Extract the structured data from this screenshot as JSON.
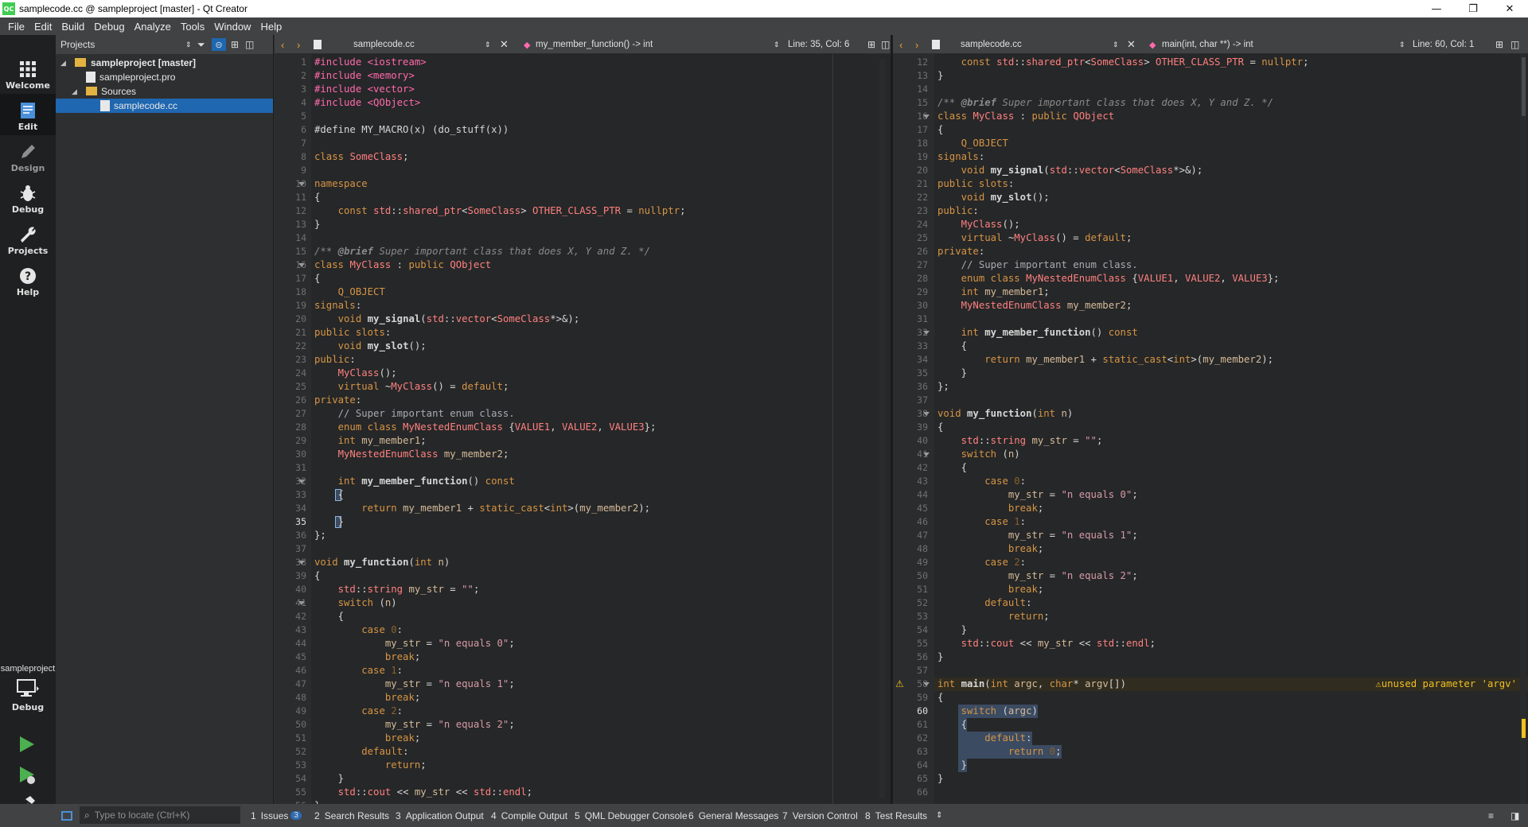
{
  "window": {
    "title": "samplecode.cc @ sampleproject [master] - Qt Creator",
    "app_badge": "QC",
    "minimize": "—",
    "maximize": "❐",
    "close": "✕"
  },
  "menu": [
    "File",
    "Edit",
    "Build",
    "Debug",
    "Analyze",
    "Tools",
    "Window",
    "Help"
  ],
  "modes": [
    {
      "label": "Welcome",
      "icon": "grid-icon"
    },
    {
      "label": "Edit",
      "icon": "edit-document-icon"
    },
    {
      "label": "Design",
      "icon": "pencil-icon"
    },
    {
      "label": "Debug",
      "icon": "bug-icon"
    },
    {
      "label": "Projects",
      "icon": "wrench-icon"
    },
    {
      "label": "Help",
      "icon": "help-icon"
    }
  ],
  "kit": {
    "project": "sampleproject",
    "build": "Debug"
  },
  "projects_panel": {
    "selector": "Projects",
    "tree": [
      {
        "label": "sampleproject [master]",
        "level": 0,
        "kind": "project"
      },
      {
        "label": "sampleproject.pro",
        "level": 1,
        "kind": "file"
      },
      {
        "label": "Sources",
        "level": 1,
        "kind": "folder"
      },
      {
        "label": "samplecode.cc",
        "level": 2,
        "kind": "file",
        "selected": true
      }
    ]
  },
  "editor_left": {
    "file": "samplecode.cc",
    "symbol": "my_member_function() -> int",
    "position": "Line: 35, Col: 6",
    "first_line": 1,
    "current_line": 35
  },
  "editor_right": {
    "file": "samplecode.cc",
    "symbol": "main(int, char **) -> int",
    "position": "Line: 60, Col: 1",
    "first_line": 12,
    "current_line": 60,
    "warning_line": 58,
    "warning": "unused parameter 'argv'",
    "warning_icon": "⚠"
  },
  "status": {
    "locator_placeholder": "Type to locate (Ctrl+K)",
    "panes": [
      {
        "num": "1",
        "label": "Issues",
        "badge": "3"
      },
      {
        "num": "2",
        "label": "Search Results"
      },
      {
        "num": "3",
        "label": "Application Output"
      },
      {
        "num": "4",
        "label": "Compile Output"
      },
      {
        "num": "5",
        "label": "QML Debugger Console"
      },
      {
        "num": "6",
        "label": "General Messages"
      },
      {
        "num": "7",
        "label": "Version Control"
      },
      {
        "num": "8",
        "label": "Test Results"
      }
    ]
  },
  "code": [
    "#include <iostream>",
    "#include <memory>",
    "#include <vector>",
    "#include <QObject>",
    "",
    "#define MY_MACRO(x) (do_stuff(x))",
    "",
    "class SomeClass;",
    "",
    "namespace",
    "{",
    "    const std::shared_ptr<SomeClass> OTHER_CLASS_PTR = nullptr;",
    "}",
    "",
    "/** @brief Super important class that does X, Y and Z. */",
    "class MyClass : public QObject",
    "{",
    "    Q_OBJECT",
    "signals:",
    "    void my_signal(std::vector<SomeClass*>&);",
    "public slots:",
    "    void my_slot();",
    "public:",
    "    MyClass();",
    "    virtual ~MyClass() = default;",
    "private:",
    "    // Super important enum class.",
    "    enum class MyNestedEnumClass {VALUE1, VALUE2, VALUE3};",
    "    int my_member1;",
    "    MyNestedEnumClass my_member2;",
    "",
    "    int my_member_function() const",
    "    {",
    "        return my_member1 + static_cast<int>(my_member2);",
    "    }",
    "};",
    "",
    "void my_function(int n)",
    "{",
    "    std::string my_str = \"\";",
    "    switch (n)",
    "    {",
    "        case 0:",
    "            my_str = \"n equals 0\";",
    "            break;",
    "        case 1:",
    "            my_str = \"n equals 1\";",
    "            break;",
    "        case 2:",
    "            my_str = \"n equals 2\";",
    "            break;",
    "        default:",
    "            return;",
    "    }",
    "    std::cout << my_str << std::endl;",
    "}",
    "",
    "int main(int argc, char* argv[])",
    "{",
    "    switch (argc)",
    "    {",
    "        default:",
    "            return 0;",
    "    }",
    "}",
    ""
  ]
}
